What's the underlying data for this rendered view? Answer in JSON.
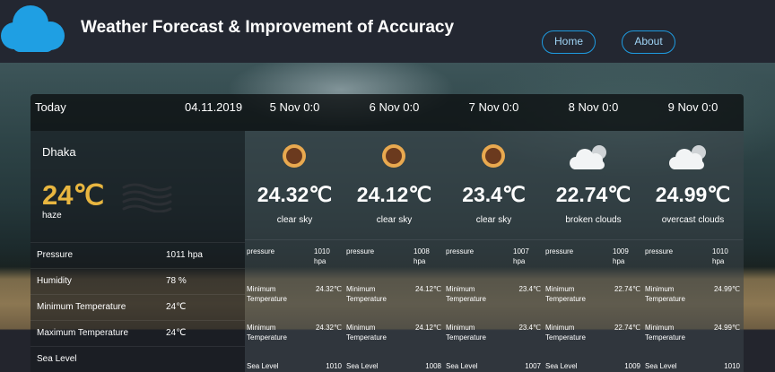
{
  "header": {
    "title": "Weather Forecast & Improvement of Accuracy",
    "nav": {
      "home": "Home",
      "about": "About"
    },
    "logo_icon": "cloud-icon",
    "accent": "#1e9be0"
  },
  "today": {
    "label": "Today",
    "date": "04.11.2019",
    "city": "Dhaka",
    "temp": "24℃",
    "description": "haze",
    "icon": "haze-icon",
    "rows": [
      {
        "label": "Pressure",
        "value": "1011 hpa"
      },
      {
        "label": "Humidity",
        "value": "78 %"
      },
      {
        "label": "Minimum Temperature",
        "value": "24℃"
      },
      {
        "label": "Maximum Temperature",
        "value": "24℃"
      },
      {
        "label": "Sea Level",
        "value": ""
      }
    ]
  },
  "forecast": [
    {
      "date": "5 Nov 0:0",
      "icon": "sun-icon",
      "temp": "24.32℃",
      "desc": "clear sky",
      "pressure_label": "pressure",
      "pressure": "1010 hpa",
      "min_label": "Minimum Temperature",
      "min": "24.32℃",
      "max_label": "Minimum Temperature",
      "max": "24.32℃",
      "sea_label": "Sea Level",
      "sea": "1010"
    },
    {
      "date": "6 Nov 0:0",
      "icon": "sun-icon",
      "temp": "24.12℃",
      "desc": "clear sky",
      "pressure_label": "pressure",
      "pressure": "1008 hpa",
      "min_label": "Minimum Temperature",
      "min": "24.12℃",
      "max_label": "Minimum Temperature",
      "max": "24.12℃",
      "sea_label": "Sea Level",
      "sea": "1008"
    },
    {
      "date": "7 Nov 0:0",
      "icon": "sun-icon",
      "temp": "23.4℃",
      "desc": "clear sky",
      "pressure_label": "pressure",
      "pressure": "1007 hpa",
      "min_label": "Minimum Temperature",
      "min": "23.4℃",
      "max_label": "Minimum Temperature",
      "max": "23.4℃",
      "sea_label": "Sea Level",
      "sea": "1007"
    },
    {
      "date": "8 Nov 0:0",
      "icon": "cloud-icon",
      "temp": "22.74℃",
      "desc": "broken clouds",
      "pressure_label": "pressure",
      "pressure": "1009 hpa",
      "min_label": "Minimum Temperature",
      "min": "22.74℃",
      "max_label": "Minimum Temperature",
      "max": "22.74℃",
      "sea_label": "Sea Level",
      "sea": "1009"
    },
    {
      "date": "9 Nov 0:0",
      "icon": "cloud-icon",
      "temp": "24.99℃",
      "desc": "overcast clouds",
      "pressure_label": "pressure",
      "pressure": "1010 hpa",
      "min_label": "Minimum Temperature",
      "min": "24.99℃",
      "max_label": "Minimum Temperature",
      "max": "24.99℃",
      "sea_label": "Sea Level",
      "sea": "1010"
    }
  ]
}
